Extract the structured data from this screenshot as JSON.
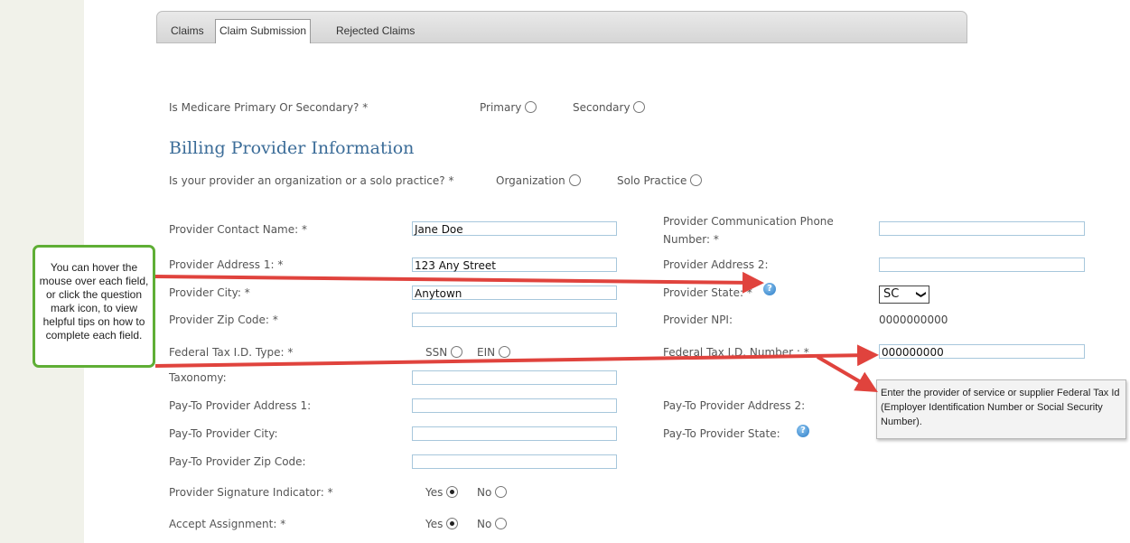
{
  "tabs": [
    "Claims",
    "Claim Submission",
    "Rejected Claims"
  ],
  "medicare": {
    "question": "Is Medicare Primary Or Secondary?",
    "required_mark": "*",
    "options": [
      {
        "label": "Primary",
        "checked": false
      },
      {
        "label": "Secondary",
        "checked": false
      }
    ]
  },
  "billing": {
    "heading": "Billing Provider Information",
    "org_question": "Is your provider an organization or a solo practice?",
    "org_options": [
      {
        "label": "Organization",
        "checked": false
      },
      {
        "label": "Solo Practice",
        "checked": false
      }
    ]
  },
  "fields": {
    "contact_name": {
      "label": "Provider Contact Name:",
      "value": "Jane Doe"
    },
    "phone": {
      "label_line1": "Provider Communication Phone",
      "label_line2": "Number:",
      "value": ""
    },
    "address1": {
      "label": "Provider Address 1:",
      "value": "123 Any Street"
    },
    "address2": {
      "label": "Provider Address 2:",
      "value": ""
    },
    "city": {
      "label": "Provider City:",
      "value": "Anytown"
    },
    "state": {
      "label": "Provider State:",
      "value": "SC",
      "caret": "❯"
    },
    "zip": {
      "label": "Provider Zip Code:",
      "value": ""
    },
    "npi": {
      "label": "Provider NPI:",
      "value": "0000000000"
    },
    "tax_type": {
      "label": "Federal Tax I.D. Type:",
      "options": [
        {
          "label": "SSN",
          "checked": false
        },
        {
          "label": "EIN",
          "checked": false
        }
      ]
    },
    "tax_number": {
      "label": "Federal Tax I.D. Number :",
      "value": "000000000"
    },
    "taxonomy": {
      "label": "Taxonomy:",
      "value": ""
    },
    "payto_address1": {
      "label": "Pay-To Provider Address 1:",
      "value": ""
    },
    "payto_address2": {
      "label": "Pay-To Provider Address 2:"
    },
    "payto_city": {
      "label": "Pay-To Provider City:",
      "value": ""
    },
    "payto_state": {
      "label": "Pay-To Provider State:"
    },
    "payto_zip": {
      "label": "Pay-To Provider Zip Code:",
      "value": ""
    },
    "signature": {
      "label": "Provider Signature Indicator:",
      "options": [
        {
          "label": "Yes",
          "checked": true
        },
        {
          "label": "No",
          "checked": false
        }
      ]
    },
    "assignment": {
      "label": "Accept Assignment:",
      "options": [
        {
          "label": "Yes",
          "checked": true
        },
        {
          "label": "No",
          "checked": false
        }
      ]
    }
  },
  "help_icon": "?",
  "callout_text": "You can hover the mouse over each field, or click the question mark icon, to view helpful tips on how to complete each field.",
  "tooltip_text": "Enter the provider of service or supplier Federal Tax Id (Employer Identification Number or Social Security Number).",
  "colors": {
    "heading": "#3b6c98",
    "arrow": "#e0433d",
    "callout_border": "#5fae35",
    "input_border": "#a7c7dc"
  }
}
